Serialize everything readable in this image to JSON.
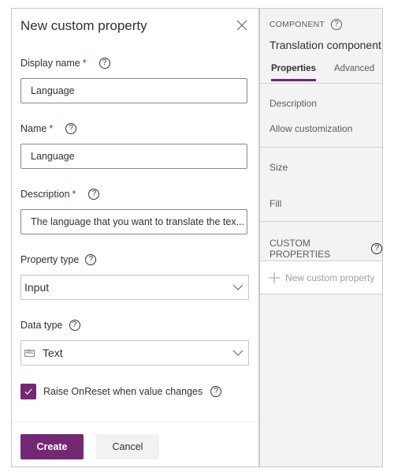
{
  "dialog": {
    "title": "New custom property",
    "close_icon": "close-icon",
    "fields": {
      "display_name": {
        "label": "Display name",
        "required_marker": "*",
        "value": "Language"
      },
      "name": {
        "label": "Name",
        "required_marker": "*",
        "value": "Language"
      },
      "description": {
        "label": "Description",
        "required_marker": "*",
        "value": "The language that you want to translate the tex..."
      },
      "property_type": {
        "label": "Property type",
        "selected": "Input"
      },
      "data_type": {
        "label": "Data type",
        "selected": "Text",
        "icon": "abc-text-icon",
        "icon_text": "Abc"
      }
    },
    "help_glyph": "?",
    "checkbox": {
      "label": "Raise OnReset when value changes",
      "checked": true
    },
    "buttons": {
      "create": "Create",
      "cancel": "Cancel"
    }
  },
  "panel": {
    "heading": "COMPONENT",
    "title": "Translation component",
    "tabs": [
      {
        "label": "Properties",
        "active": true
      },
      {
        "label": "Advanced",
        "active": false
      }
    ],
    "properties": [
      "Description",
      "Allow customization",
      "Size",
      "Fill"
    ],
    "custom_heading": "CUSTOM PROPERTIES",
    "new_custom_property": "New custom property"
  },
  "colors": {
    "accent": "#742774",
    "panel_bg": "#f3f3f3",
    "border": "#c8c8c8"
  }
}
